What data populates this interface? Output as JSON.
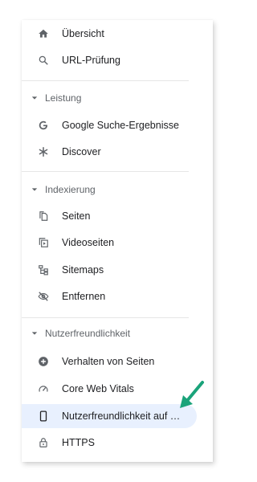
{
  "top_items": [
    {
      "label": "Übersicht",
      "icon": "home-icon"
    },
    {
      "label": "URL-Prüfung",
      "icon": "search-icon"
    }
  ],
  "sections": [
    {
      "title": "Leistung",
      "items": [
        {
          "label": "Google Suche-Ergebnisse",
          "icon": "google-g-icon"
        },
        {
          "label": "Discover",
          "icon": "asterisk-icon"
        }
      ]
    },
    {
      "title": "Indexierung",
      "items": [
        {
          "label": "Seiten",
          "icon": "pages-icon"
        },
        {
          "label": "Videoseiten",
          "icon": "video-pages-icon"
        },
        {
          "label": "Sitemaps",
          "icon": "sitemap-icon"
        },
        {
          "label": "Entfernen",
          "icon": "eye-off-icon"
        }
      ]
    },
    {
      "title": "Nutzerfreundlichkeit",
      "items": [
        {
          "label": "Verhalten von Seiten",
          "icon": "plus-circle-icon"
        },
        {
          "label": "Core Web Vitals",
          "icon": "gauge-icon"
        },
        {
          "label": "Nutzerfreundlichkeit auf Mobilgeräten",
          "icon": "smartphone-icon",
          "active": true
        },
        {
          "label": "HTTPS",
          "icon": "lock-icon"
        }
      ]
    }
  ],
  "colors": {
    "active_bg": "#e8f0fe",
    "icon": "#5f6368",
    "annotation_arrow": "#1aa37a"
  }
}
